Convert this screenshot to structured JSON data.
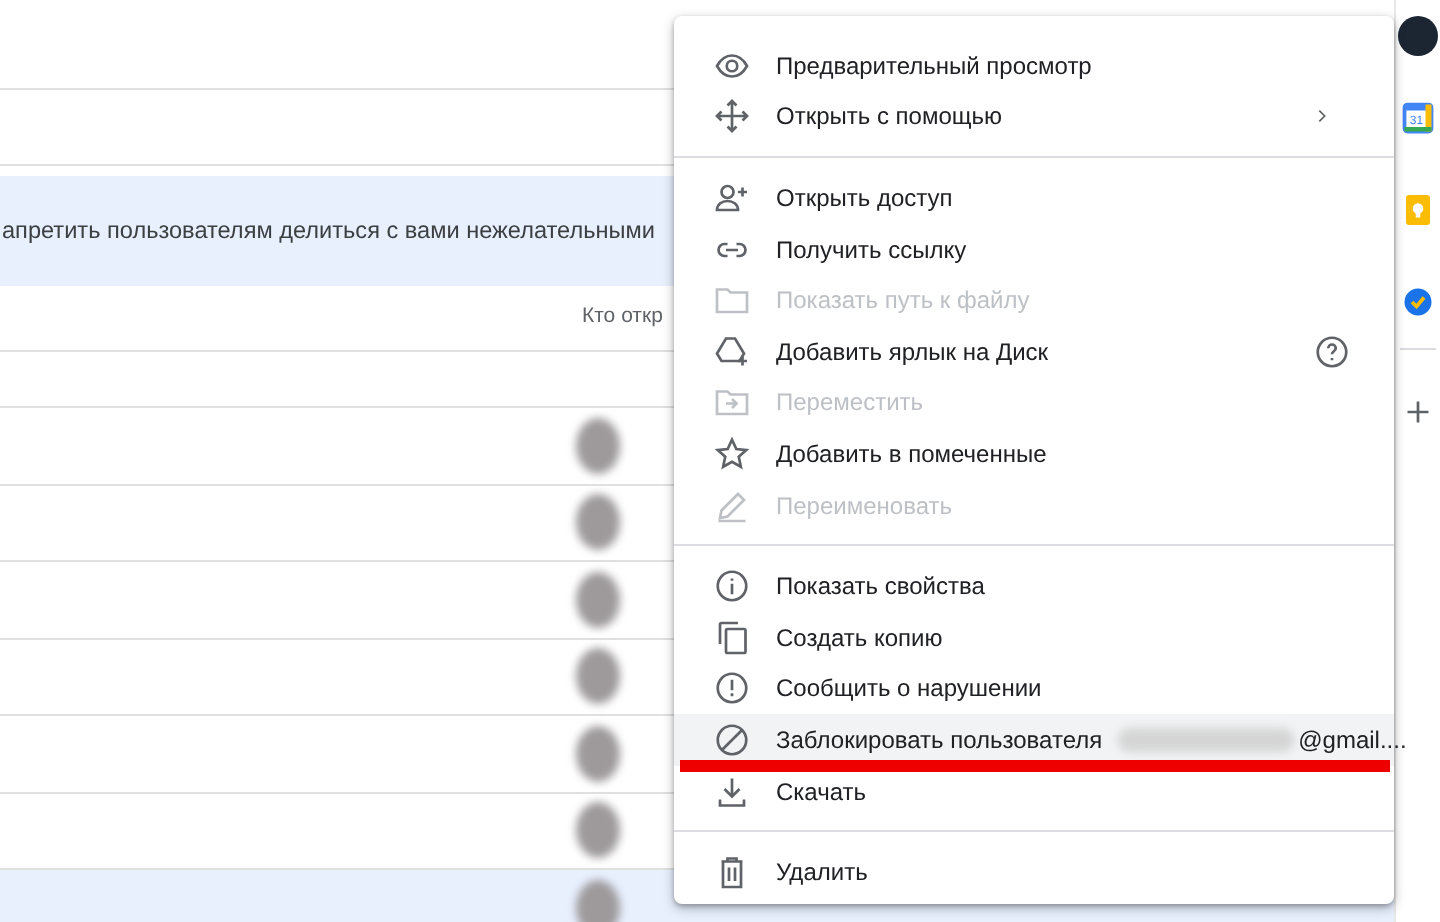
{
  "banner": {
    "text": "апретить пользователям делиться с вами нежелательными"
  },
  "table": {
    "columns": [
      {
        "label": "Кто откр"
      }
    ],
    "rows": [
      {
        "avatar": false,
        "selected": false
      },
      {
        "avatar": true,
        "selected": false
      },
      {
        "avatar": true,
        "selected": false
      },
      {
        "avatar": true,
        "selected": false
      },
      {
        "avatar": true,
        "selected": false
      },
      {
        "avatar": true,
        "selected": false
      },
      {
        "avatar": true,
        "selected": false
      },
      {
        "avatar": true,
        "selected": true
      }
    ]
  },
  "side_panel": {
    "items": [
      {
        "kind": "calendar",
        "label": "31"
      },
      {
        "kind": "keep"
      },
      {
        "kind": "tasks"
      },
      {
        "kind": "add"
      }
    ]
  },
  "context_menu": {
    "groups": [
      [
        {
          "kind": "eye",
          "label": "Предварительный просмотр",
          "disabled": false,
          "highlighted": false
        },
        {
          "kind": "move",
          "label": "Открыть с помощью",
          "disabled": false,
          "highlighted": false,
          "submenu": true
        }
      ],
      [
        {
          "kind": "person-add",
          "label": "Открыть доступ",
          "disabled": false,
          "highlighted": false
        },
        {
          "kind": "link",
          "label": "Получить ссылку",
          "disabled": false,
          "highlighted": false
        },
        {
          "kind": "folder",
          "label": "Показать путь к файлу",
          "disabled": true,
          "highlighted": false
        },
        {
          "kind": "drive-add",
          "label": "Добавить ярлык на Диск",
          "disabled": false,
          "highlighted": false,
          "help": true
        },
        {
          "kind": "folder-move",
          "label": "Переместить",
          "disabled": true,
          "highlighted": false
        },
        {
          "kind": "star",
          "label": "Добавить в помеченные",
          "disabled": false,
          "highlighted": false
        },
        {
          "kind": "pencil",
          "label": "Переименовать",
          "disabled": true,
          "highlighted": false
        }
      ],
      [
        {
          "kind": "info",
          "label": "Показать свойства",
          "disabled": false,
          "highlighted": false
        },
        {
          "kind": "copy",
          "label": "Создать копию",
          "disabled": false,
          "highlighted": false
        },
        {
          "kind": "alert",
          "label": "Сообщить о нарушении",
          "disabled": false,
          "highlighted": false
        },
        {
          "kind": "block",
          "label": "Заблокировать пользователя",
          "suffix": "@gmail....",
          "redacted": true,
          "disabled": false,
          "highlighted": true,
          "underlined": true
        },
        {
          "kind": "download",
          "label": "Скачать",
          "disabled": false,
          "highlighted": false
        }
      ],
      [
        {
          "kind": "trash",
          "label": "Удалить",
          "disabled": false,
          "highlighted": false
        }
      ]
    ]
  }
}
